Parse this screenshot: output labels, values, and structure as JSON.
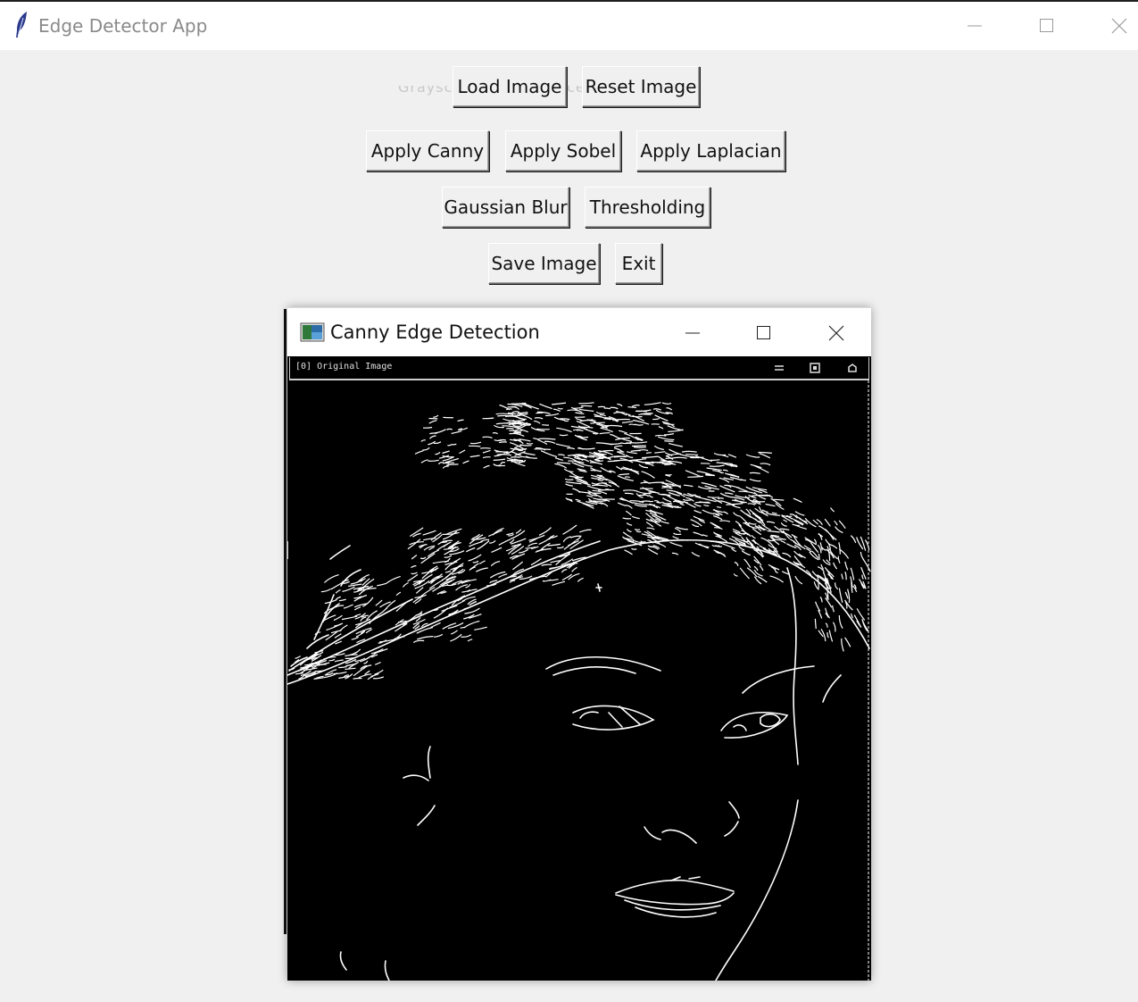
{
  "window": {
    "title": "Edge Detector App",
    "controls": [
      "minimize",
      "maximize",
      "close"
    ]
  },
  "ghost_text": "Grayscale  ·  Read  Success  ·",
  "buttons": {
    "row1": [
      "Load Image",
      "Reset Image"
    ],
    "row2": [
      "Apply Canny",
      "Apply Sobel",
      "Apply Laplacian"
    ],
    "row3": [
      "Gaussian Blur",
      "Thresholding"
    ],
    "row4": [
      "Save Image",
      "Exit"
    ]
  },
  "child_window": {
    "title": "Canny Edge Detection",
    "toolbar_label": "[0] Original Image",
    "toolbar_icons": [
      "menu-icon",
      "record-icon",
      "home-icon"
    ],
    "content": "canny-edge-output-image"
  },
  "colors": {
    "background": "#f0f0f0",
    "titlebar": "#ffffff",
    "title_text": "#8a8a8a",
    "canvas": "#000000",
    "edges": "#ffffff"
  }
}
